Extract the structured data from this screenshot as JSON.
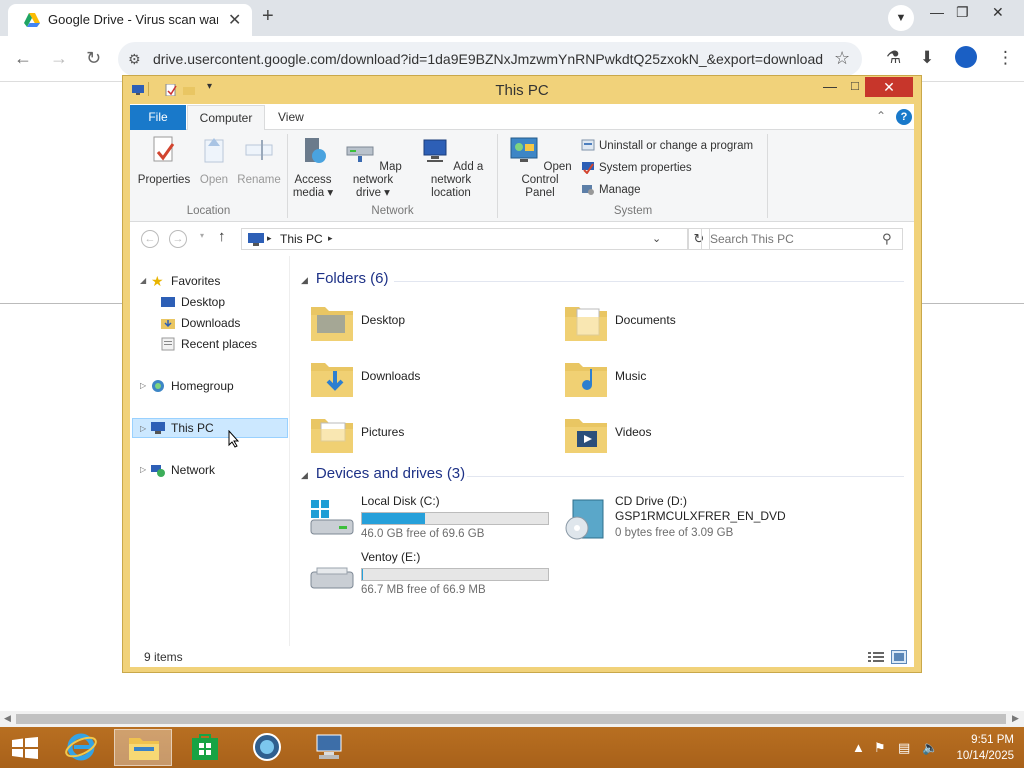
{
  "browser": {
    "tab_title": "Google Drive - Virus scan warni",
    "url": "drive.usercontent.google.com/download?id=1da9E9BZNxJmzwmYnRNPwkdtQ25zxokN_&export=download",
    "new_tab_symbol": "+",
    "close_symbol": "✕"
  },
  "explorer": {
    "title": "This PC",
    "ribbon_tabs": [
      "File",
      "Computer",
      "View"
    ],
    "location_group": {
      "label": "Location",
      "buttons": [
        "Properties",
        "Open",
        "Rename"
      ]
    },
    "network_group": {
      "label": "Network",
      "access_media_line1": "Access",
      "access_media_line2": "media",
      "map_drive_line1": "Map network",
      "map_drive_line2": "drive",
      "add_location_line1": "Add a network",
      "add_location_line2": "location"
    },
    "system_group": {
      "label": "System",
      "control_panel_line1": "Open Control",
      "control_panel_line2": "Panel",
      "uninstall": "Uninstall or change a program",
      "system_properties": "System properties",
      "manage": "Manage"
    },
    "address": "This PC",
    "search_placeholder": "Search This PC",
    "nav": {
      "favorites": "Favorites",
      "desktop": "Desktop",
      "downloads": "Downloads",
      "recent": "Recent places",
      "homegroup": "Homegroup",
      "thispc": "This PC",
      "network": "Network"
    },
    "folders_header": "Folders (6)",
    "folders": [
      "Desktop",
      "Documents",
      "Downloads",
      "Music",
      "Pictures",
      "Videos"
    ],
    "devices_header": "Devices and drives (3)",
    "drives": [
      {
        "name": "Local Disk (C:)",
        "free": "46.0 GB free of 69.6 GB",
        "used_fraction": 0.34
      },
      {
        "name": "CD Drive (D:)",
        "label": "GSP1RMCULXFRER_EN_DVD",
        "free": "0 bytes free of 3.09 GB"
      },
      {
        "name": "Ventoy (E:)",
        "free": "66.7 MB free of 66.9 MB",
        "used_fraction": 0.003
      }
    ],
    "status": "9 items"
  },
  "taskbar": {
    "time": "9:51 PM",
    "date": "10/14/2025"
  },
  "colors": {
    "window_frame": "#f1d27a",
    "file_tab": "#1979ca",
    "drive_bar": "#26a0da",
    "taskbar": "#b06a1e",
    "close_button": "#c7362b"
  }
}
